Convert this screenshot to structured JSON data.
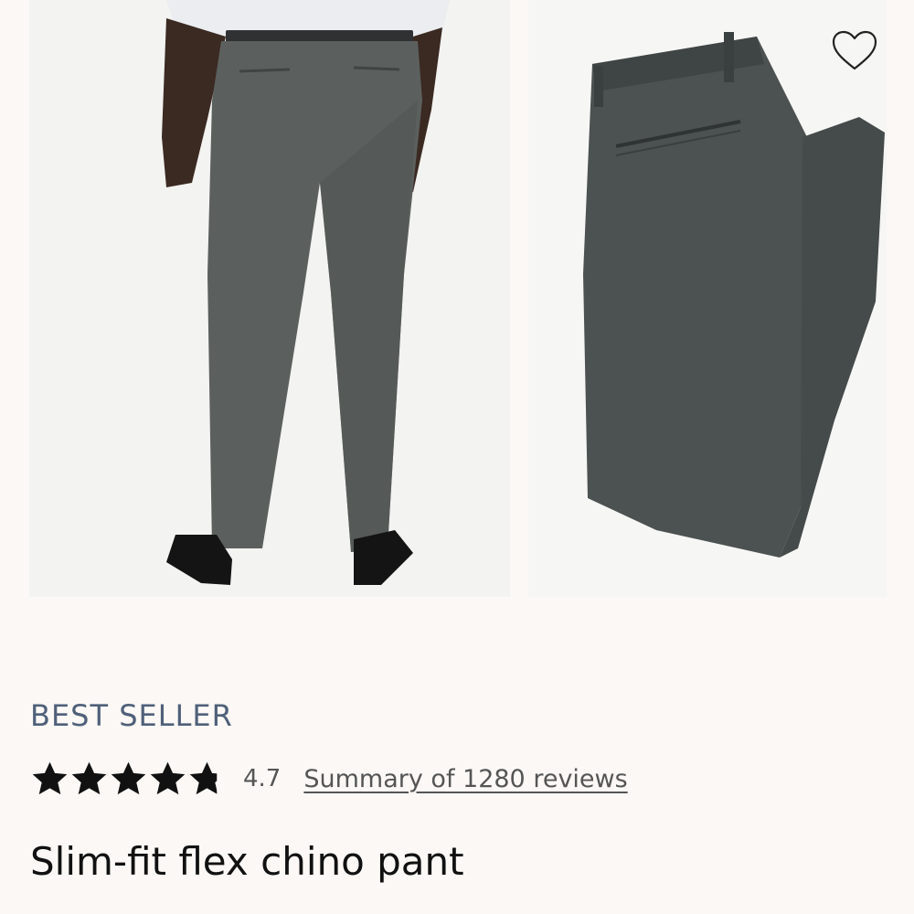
{
  "product": {
    "badge": "BEST SELLER",
    "rating": {
      "stars": 4.7,
      "value_label": "4.7",
      "reviews_link": "Summary of 1280 reviews"
    },
    "title": "Slim-fit flex chino pant",
    "images": [
      {
        "icon": "model-back-view-image"
      },
      {
        "icon": "folded-pant-image"
      }
    ]
  },
  "colors": {
    "background": "#fbf8f5",
    "badge": "#4f6079",
    "pant": "#4b5251",
    "text": "#111111"
  }
}
